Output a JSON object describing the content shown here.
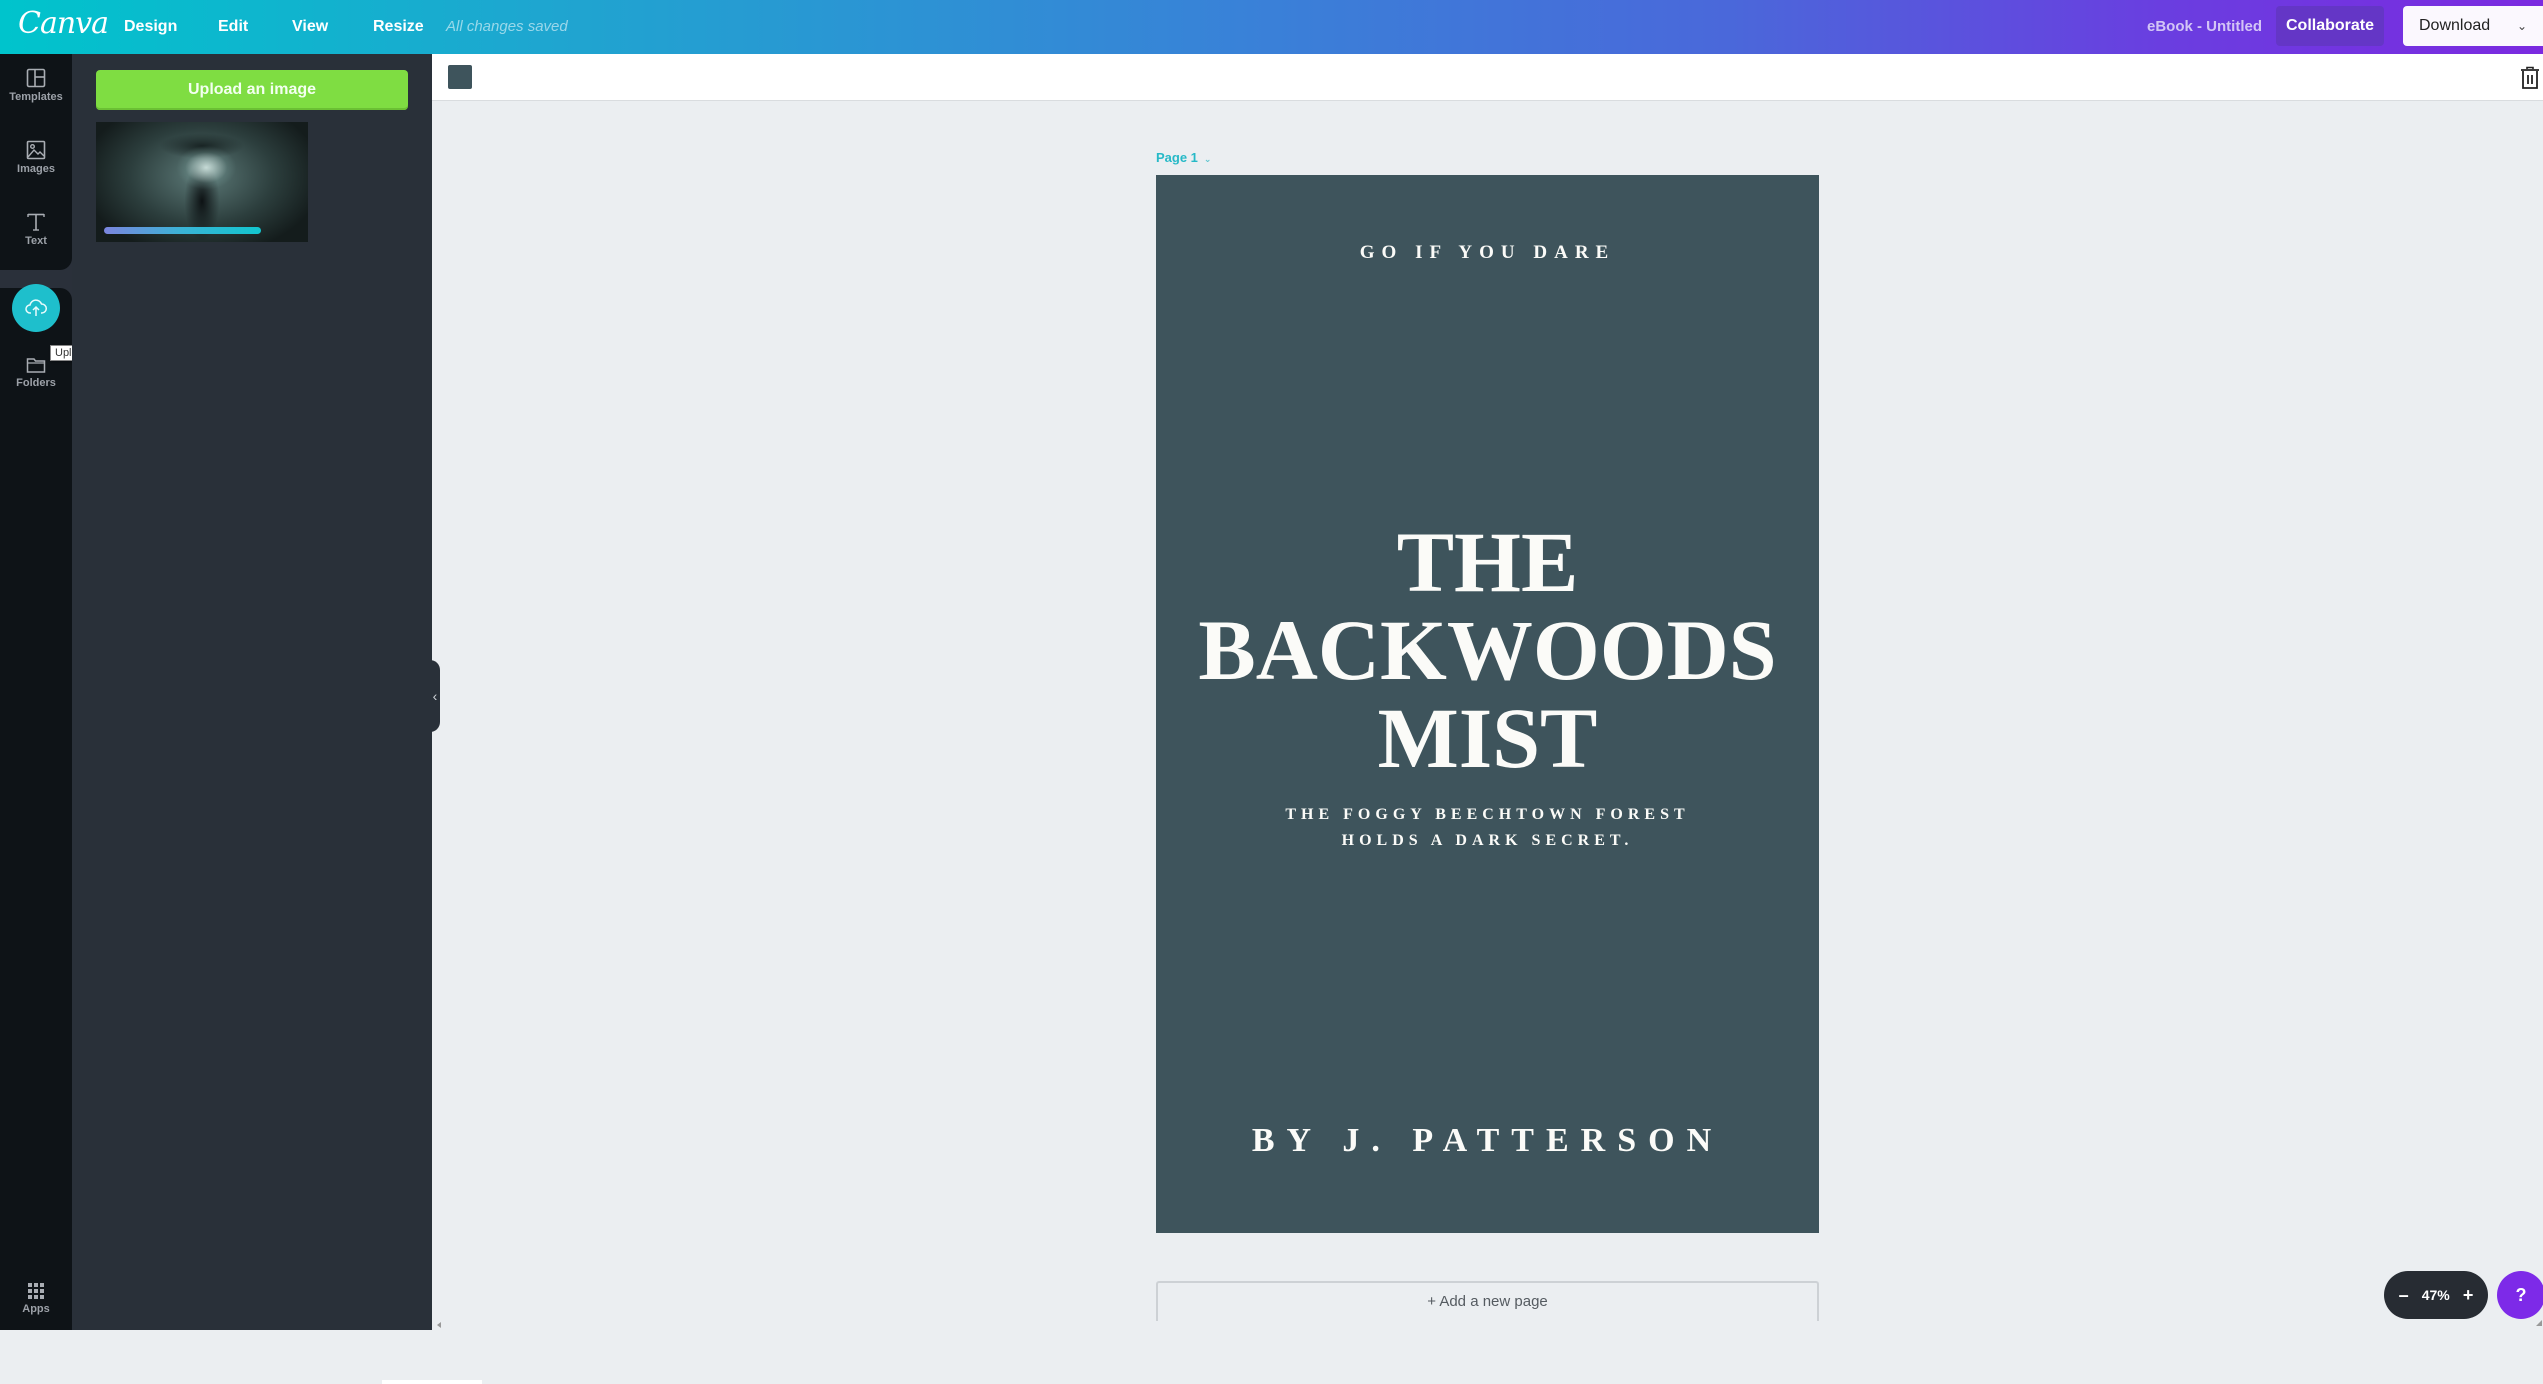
{
  "header": {
    "logo": "Canva",
    "menu": [
      {
        "label": "Design"
      },
      {
        "label": "Edit"
      },
      {
        "label": "View"
      },
      {
        "label": "Resize"
      }
    ],
    "save_status": "All changes saved",
    "document_title": "eBook - Untitled",
    "collaborate_label": "Collaborate",
    "download_label": "Download",
    "download_chevron": "⌄"
  },
  "rail": {
    "items": [
      {
        "label": "Templates",
        "icon": "templates-icon"
      },
      {
        "label": "Images",
        "icon": "image-icon"
      },
      {
        "label": "Text",
        "icon": "text-icon"
      },
      {
        "label": "Uploads",
        "icon": "cloud-upload-icon",
        "active": true
      },
      {
        "label": "Folders",
        "icon": "folder-icon"
      },
      {
        "label": "Apps",
        "icon": "apps-grid-icon"
      }
    ],
    "tooltip": "Uploads"
  },
  "panel": {
    "upload_button_label": "Upload an image",
    "uploads": [
      {
        "description": "Dark forest scene with raven",
        "progress_percent": 80
      }
    ],
    "collapse_glyph": "‹"
  },
  "toolbar": {
    "background_color": "#3e545c"
  },
  "canvas": {
    "page_label": "Page 1",
    "page_chevron": "⌄",
    "page_background": "#3e545c",
    "cover": {
      "tagline": "GO IF YOU DARE",
      "title_lines": [
        "THE",
        "BACKWOODS",
        "MIST"
      ],
      "subtitle_lines": [
        "THE FOGGY BEECHTOWN FOREST",
        "HOLDS A DARK SECRET."
      ],
      "author": "BY J. PATTERSON"
    },
    "add_page_label": "+ Add a new page"
  },
  "zoom": {
    "minus": "–",
    "value": "47%",
    "plus": "+"
  },
  "help_label": "?",
  "colors": {
    "accent_teal": "#00c4cc",
    "accent_purple": "#7d2ae8",
    "upload_green": "#7fdd42"
  }
}
